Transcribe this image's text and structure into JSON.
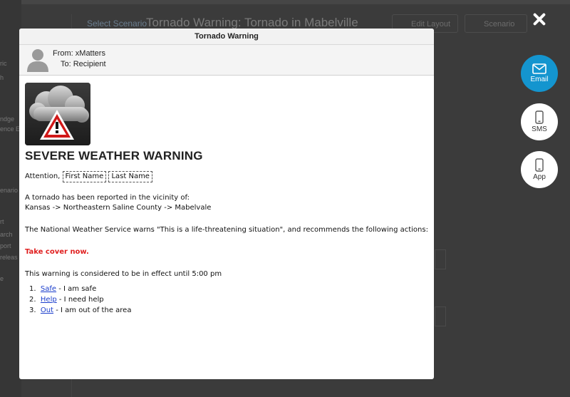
{
  "background": {
    "link": "Select Scenario",
    "title": "Tornado Warning: Tornado in Mabelville",
    "edit_layout": "Edit Layout",
    "scenario": "Scenario",
    "sidebar_fragments": [
      "ric",
      "h",
      "ndge",
      "ence E",
      "enario",
      "rt",
      "arch",
      "port",
      "releas",
      "e"
    ]
  },
  "modal": {
    "title": "Tornado Warning",
    "from": "From: xMatters",
    "to": "To: Recipient"
  },
  "email": {
    "headline": "SEVERE WEATHER WARNING",
    "attention": "Attention,",
    "first_name": "First Name",
    "last_name": "Last Name",
    "reported": "A tornado has been reported in the vicinity of:",
    "location": "Kansas -> Northeastern Saline County -> Mabelvale",
    "nws": "The National Weather Service warns \"This is a life-threatening situation\", and recommends the following actions:",
    "action": "Take cover now.",
    "effect": "This warning is considered to be in effect until 5:00 pm",
    "options": [
      {
        "num": "1.",
        "link": "Safe",
        "text": " - I am safe"
      },
      {
        "num": "2.",
        "link": "Help",
        "text": " - I need help"
      },
      {
        "num": "3.",
        "link": "Out",
        "text": " - I am out of the area"
      }
    ]
  },
  "channels": {
    "email": "Email",
    "sms": "SMS",
    "app": "App"
  },
  "colors": {
    "accent": "#1495cf",
    "warning_red": "#e02020",
    "link": "#1a3dcc"
  },
  "icons": {
    "close": "close-icon",
    "email": "envelope-icon",
    "sms": "phone-icon",
    "app": "mobile-app-icon",
    "avatar": "user-avatar-icon",
    "weather": "storm-warning-icon"
  }
}
